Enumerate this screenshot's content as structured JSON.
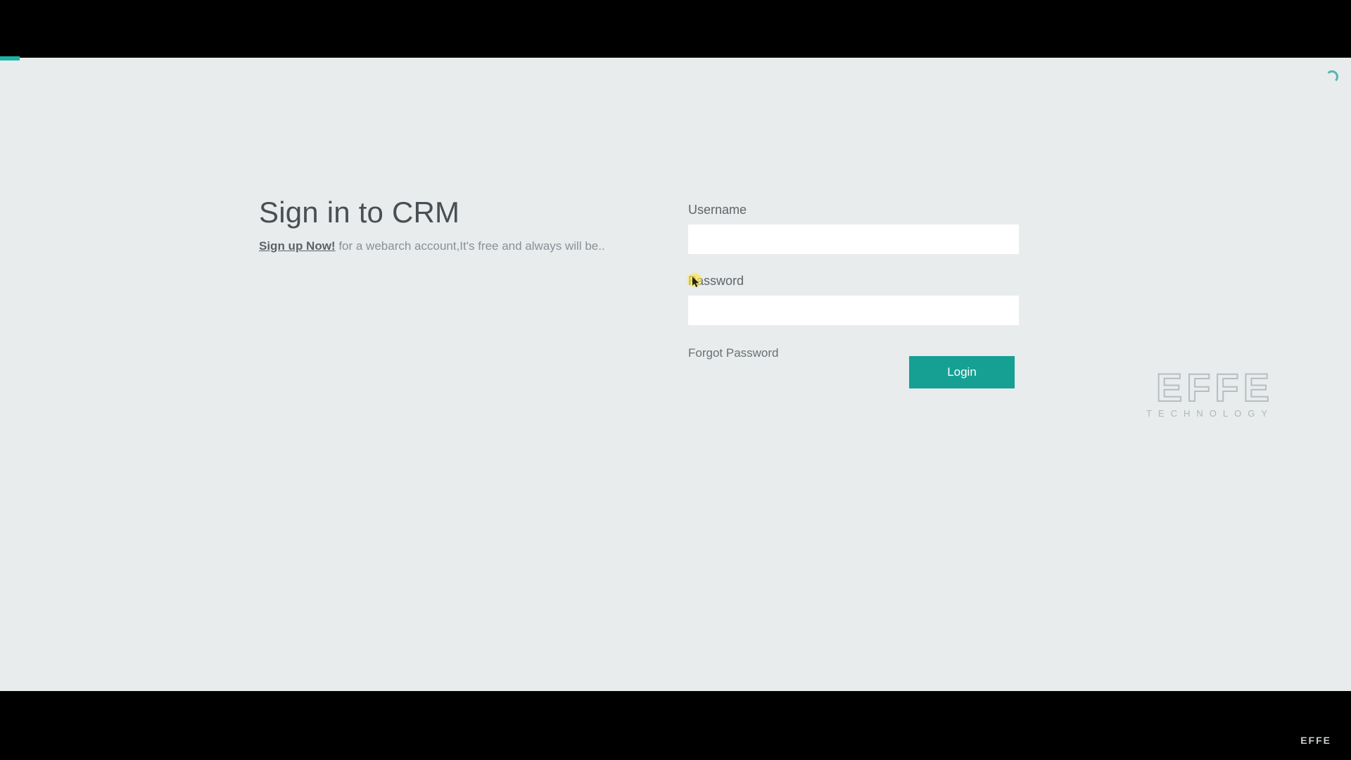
{
  "page": {
    "heading": "Sign in to CRM",
    "signup_lead": "Sign up Now!",
    "signup_rest": " for a webarch account,It's free and always will be.."
  },
  "form": {
    "username_label": "Username",
    "username_value": "",
    "password_label": "Password",
    "password_value": "",
    "forgot_label": "Forgot Password",
    "login_label": "Login"
  },
  "brand": {
    "name": "EFFE",
    "tagline": "TECHNOLOGY"
  },
  "colors": {
    "accent": "#16a094",
    "page_bg": "#e8eced"
  }
}
